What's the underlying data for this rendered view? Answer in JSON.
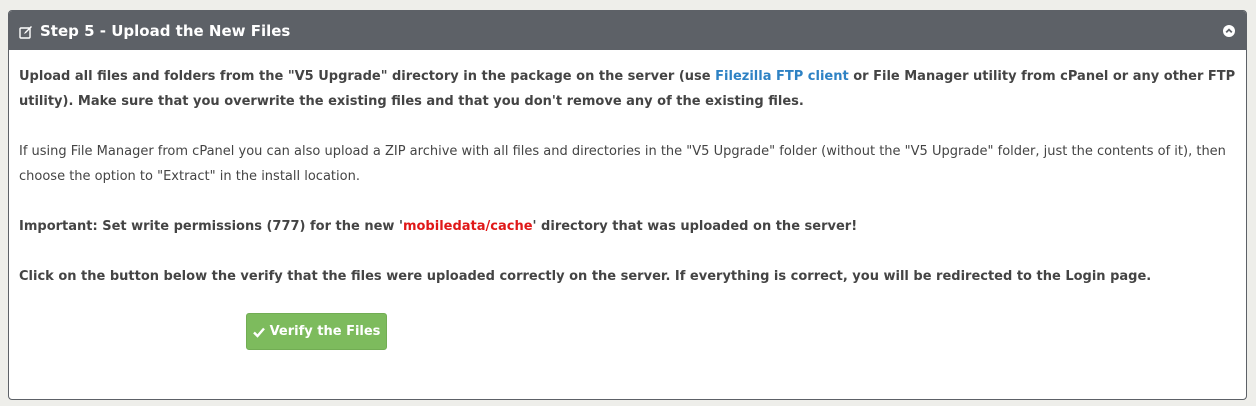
{
  "panel": {
    "title": "Step 5 - Upload the New Files",
    "header_icon": "edit-icon",
    "collapse_icon": "chevron-up-circle-icon"
  },
  "body": {
    "p1": {
      "part1": "Upload all files and folders from the \"V5 Upgrade\" directory in the package on the server (use ",
      "link": "Filezilla FTP client",
      "part2": " or File Manager utility from cPanel or any other FTP utility). Make sure that you overwrite the existing files and that you don't remove any of the existing files."
    },
    "p2": "If using File Manager from cPanel you can also upload a ZIP archive with all files and directories in the \"V5 Upgrade\" folder (without the \"V5 Upgrade\" folder, just the contents of it), then choose the option to \"Extract\" in the install location.",
    "p3": {
      "part1": "Important: Set write permissions (777) for the new '",
      "path": "mobiledata/cache",
      "part2": "' directory that was uploaded on the server!"
    },
    "p4": "Click on the button below the verify that the files were uploaded correctly on the server. If everything is correct, you will be redirected to the Login page."
  },
  "verify_button": {
    "label": "Verify the Files",
    "icon": "check-icon"
  },
  "colors": {
    "header_bg": "#5d6167",
    "link": "#2e82c4",
    "path": "#e01818",
    "button_bg": "#7dbb5d"
  }
}
